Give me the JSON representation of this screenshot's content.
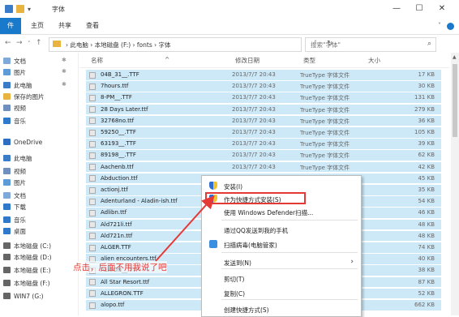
{
  "window": {
    "title": "字体",
    "minimize": "—",
    "maximize": "☐",
    "close": "✕"
  },
  "ribbon": {
    "file": "件",
    "tabs": [
      "主页",
      "共享",
      "查看"
    ]
  },
  "address": {
    "crumbs": "› 此电脑 › 本地磁盘 (F:) › fonts › 字体",
    "search_placeholder": "搜索\"字体\""
  },
  "nav": [
    {
      "label": "文档",
      "color": "#7fa9d9"
    },
    {
      "label": "图片",
      "color": "#5c9bd6"
    },
    {
      "label": "此电脑",
      "color": "#3a7cc7"
    },
    {
      "label": "保存的图片",
      "color": "#e8b33f"
    },
    {
      "label": "视频",
      "color": "#6f8fbf"
    },
    {
      "label": "音乐",
      "color": "#2f79c9"
    },
    {
      "label": "OneDrive",
      "color": "#2e6ec1"
    },
    {
      "label": "此电脑",
      "color": "#3a7cc7"
    },
    {
      "label": "视频",
      "color": "#6f8fbf"
    },
    {
      "label": "图片",
      "color": "#5c9bd6"
    },
    {
      "label": "文档",
      "color": "#7fa9d9"
    },
    {
      "label": "下载",
      "color": "#2f79c9"
    },
    {
      "label": "音乐",
      "color": "#2f79c9"
    },
    {
      "label": "桌面",
      "color": "#2f79c9"
    },
    {
      "label": "本地磁盘 (C:)",
      "color": "#666666"
    },
    {
      "label": "本地磁盘 (D:)",
      "color": "#666666"
    },
    {
      "label": "本地磁盘 (E:)",
      "color": "#666666"
    },
    {
      "label": "本地磁盘 (F:)",
      "color": "#666666"
    },
    {
      "label": "WIN7 (G:)",
      "color": "#666666"
    }
  ],
  "columns": {
    "name": "名称",
    "date": "修改日期",
    "type": "类型",
    "size": "大小"
  },
  "files": [
    {
      "name": "04B_31__.TTF",
      "date": "2013/7/7 20:43",
      "type": "TrueType 字体文件",
      "size": "17 KB"
    },
    {
      "name": "7hours.ttf",
      "date": "2013/7/7 20:43",
      "type": "TrueType 字体文件",
      "size": "30 KB"
    },
    {
      "name": "8-PM__.TTF",
      "date": "2013/7/7 20:43",
      "type": "TrueType 字体文件",
      "size": "131 KB"
    },
    {
      "name": "28 Days Later.ttf",
      "date": "2013/7/7 20:43",
      "type": "TrueType 字体文件",
      "size": "279 KB"
    },
    {
      "name": "32768no.ttf",
      "date": "2013/7/7 20:43",
      "type": "TrueType 字体文件",
      "size": "36 KB"
    },
    {
      "name": "59250__.TTF",
      "date": "2013/7/7 20:43",
      "type": "TrueType 字体文件",
      "size": "105 KB"
    },
    {
      "name": "63193__.TTF",
      "date": "2013/7/7 20:43",
      "type": "TrueType 字体文件",
      "size": "39 KB"
    },
    {
      "name": "89198__.TTF",
      "date": "2013/7/7 20:43",
      "type": "TrueType 字体文件",
      "size": "62 KB"
    },
    {
      "name": "Aachenb.ttf",
      "date": "2013/7/7 20:43",
      "type": "TrueType 字体文件",
      "size": "42 KB"
    },
    {
      "name": "Abduction.ttf",
      "date": "",
      "type": "",
      "size": "45 KB"
    },
    {
      "name": "actionj.ttf",
      "date": "",
      "type": "",
      "size": "35 KB"
    },
    {
      "name": "Adenturland - Aladin-ish.ttf",
      "date": "",
      "type": "",
      "size": "54 KB"
    },
    {
      "name": "Adlibn.ttf",
      "date": "",
      "type": "",
      "size": "46 KB"
    },
    {
      "name": "Ald721li.ttf",
      "date": "",
      "type": "",
      "size": "48 KB"
    },
    {
      "name": "Ald721n.ttf",
      "date": "",
      "type": "",
      "size": "48 KB"
    },
    {
      "name": "ALGER.TTF",
      "date": "",
      "type": "",
      "size": "74 KB"
    },
    {
      "name": "alien encounters.ttf",
      "date": "",
      "type": "",
      "size": "40 KB"
    },
    {
      "name": "ALISON__.TTF",
      "date": "",
      "type": "",
      "size": "38 KB"
    },
    {
      "name": "All Star Resort.ttf",
      "date": "",
      "type": "",
      "size": "87 KB"
    },
    {
      "name": "ALLEGRON.TTF",
      "date": "",
      "type": "",
      "size": "52 KB"
    },
    {
      "name": "alopo.ttf",
      "date": "",
      "type": "",
      "size": "662 KB"
    }
  ],
  "context_menu": {
    "items": [
      {
        "label": "安装(I)",
        "icon": "shield-icon"
      },
      {
        "label": "作为快捷方式安装(S)",
        "icon": "shield-icon"
      },
      {
        "label": "使用 Windows Defender扫描...",
        "icon": ""
      },
      {
        "label": "通过QQ发送到我的手机",
        "icon": ""
      },
      {
        "label": "扫描病毒(电脑管家)",
        "icon": "scan-icon"
      },
      {
        "label": "发送到(N)",
        "icon": "",
        "arrow": "›"
      },
      {
        "label": "剪切(T)",
        "icon": ""
      },
      {
        "label": "复制(C)",
        "icon": ""
      },
      {
        "label": "创建快捷方式(S)",
        "icon": ""
      }
    ]
  },
  "annotation": {
    "text": "点击，后面不用我说了吧",
    "color": "#e53935"
  }
}
